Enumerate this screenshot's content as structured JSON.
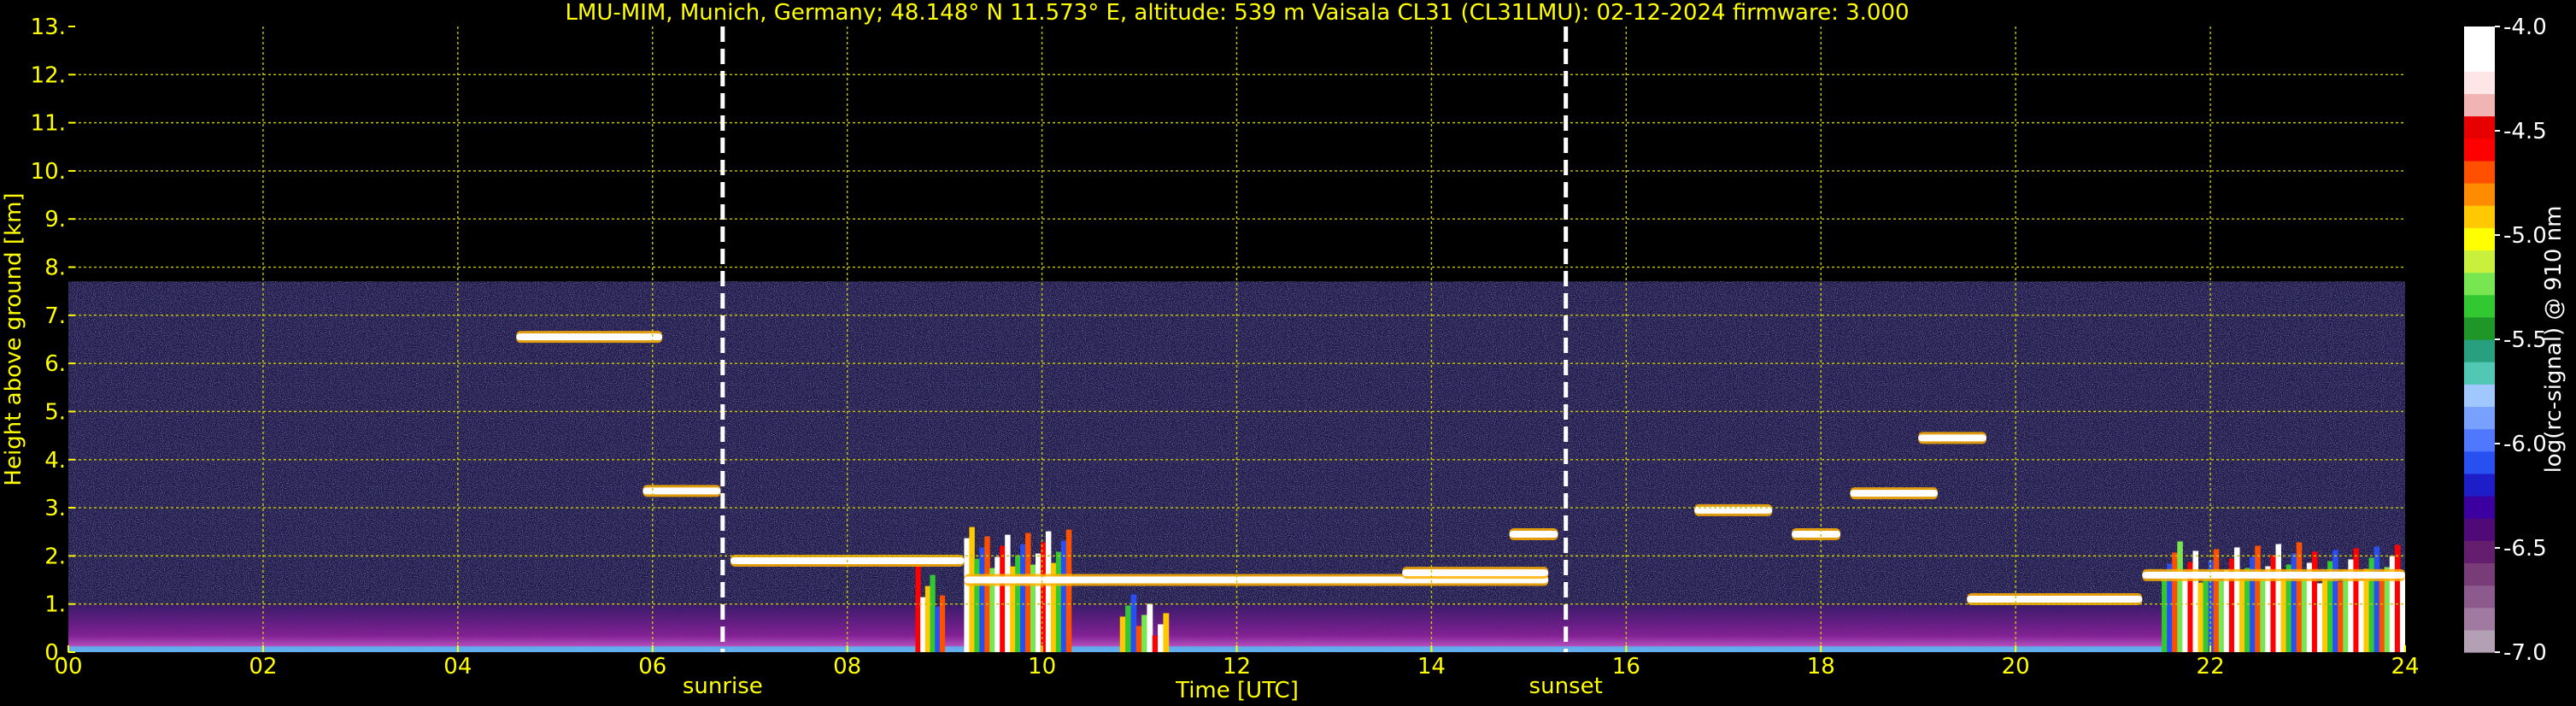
{
  "chart_data": {
    "type": "heatmap",
    "title": "LMU-MIM, Munich, Germany; 48.148° N 11.573° E, altitude: 539 m    Vaisala CL31 (CL31LMU): 02-12-2024    firmware: 3.000",
    "xlabel": "Time [UTC]",
    "ylabel": "Height above ground [km]",
    "xlim": [
      0,
      24
    ],
    "ylim": [
      0,
      13
    ],
    "x_tick_labels": [
      "00",
      "02",
      "04",
      "06",
      "08",
      "10",
      "12",
      "14",
      "16",
      "18",
      "20",
      "22",
      "24"
    ],
    "y_tick_labels": [
      "0.",
      "1.",
      "2.",
      "3.",
      "4.",
      "5.",
      "6.",
      "7.",
      "8.",
      "9.",
      "10.",
      "11.",
      "12.",
      "13."
    ],
    "grid": true,
    "grid_color": "#c8c800",
    "sun_events": [
      {
        "label": "sunrise",
        "time": 6.72
      },
      {
        "label": "sunset",
        "time": 15.38
      }
    ],
    "colorbar": {
      "label": "log(rc-signal) @ 910 nm",
      "range": [
        -7.0,
        -4.0
      ],
      "tick_labels": [
        "-4.0",
        "-4.5",
        "-5.0",
        "-5.5",
        "-6.0",
        "-6.5",
        "-7.0"
      ],
      "colors": [
        "#b4a0b4",
        "#a07aa0",
        "#8c5a8c",
        "#783c78",
        "#641e6e",
        "#500a78",
        "#3c00a0",
        "#1e1ec8",
        "#2850f0",
        "#5078ff",
        "#78a0ff",
        "#a0c8ff",
        "#50c8b4",
        "#28a080",
        "#1e9628",
        "#32c832",
        "#78e650",
        "#c8f03c",
        "#ffff00",
        "#ffc800",
        "#ff8c00",
        "#ff5000",
        "#ff0000",
        "#e60000",
        "#f0b4b4",
        "#ffe6e6",
        "#ffffff",
        "#ffffff"
      ]
    },
    "measurement_top_km": 7.7,
    "cloud_layers": [
      {
        "start": 4.6,
        "end": 6.1,
        "height": 6.55
      },
      {
        "start": 5.9,
        "end": 6.7,
        "height": 3.35
      },
      {
        "start": 6.8,
        "end": 9.2,
        "height": 1.9
      },
      {
        "start": 9.2,
        "end": 15.2,
        "height": 1.5
      },
      {
        "start": 13.7,
        "end": 15.2,
        "height": 1.65
      },
      {
        "start": 14.8,
        "end": 15.3,
        "height": 2.45
      },
      {
        "start": 16.7,
        "end": 17.5,
        "height": 2.95
      },
      {
        "start": 17.7,
        "end": 18.2,
        "height": 2.45
      },
      {
        "start": 18.3,
        "end": 19.2,
        "height": 3.3
      },
      {
        "start": 19.0,
        "end": 19.7,
        "height": 4.45
      },
      {
        "start": 19.5,
        "end": 21.3,
        "height": 1.1
      },
      {
        "start": 21.3,
        "end": 24.0,
        "height": 1.6
      }
    ],
    "precipitation_columns": [
      {
        "start": 8.7,
        "end": 9.0,
        "top": 1.8
      },
      {
        "start": 9.2,
        "end": 10.3,
        "top": 2.6
      },
      {
        "start": 10.8,
        "end": 11.3,
        "top": 1.2
      },
      {
        "start": 21.5,
        "end": 24.0,
        "top": 2.3
      }
    ]
  }
}
